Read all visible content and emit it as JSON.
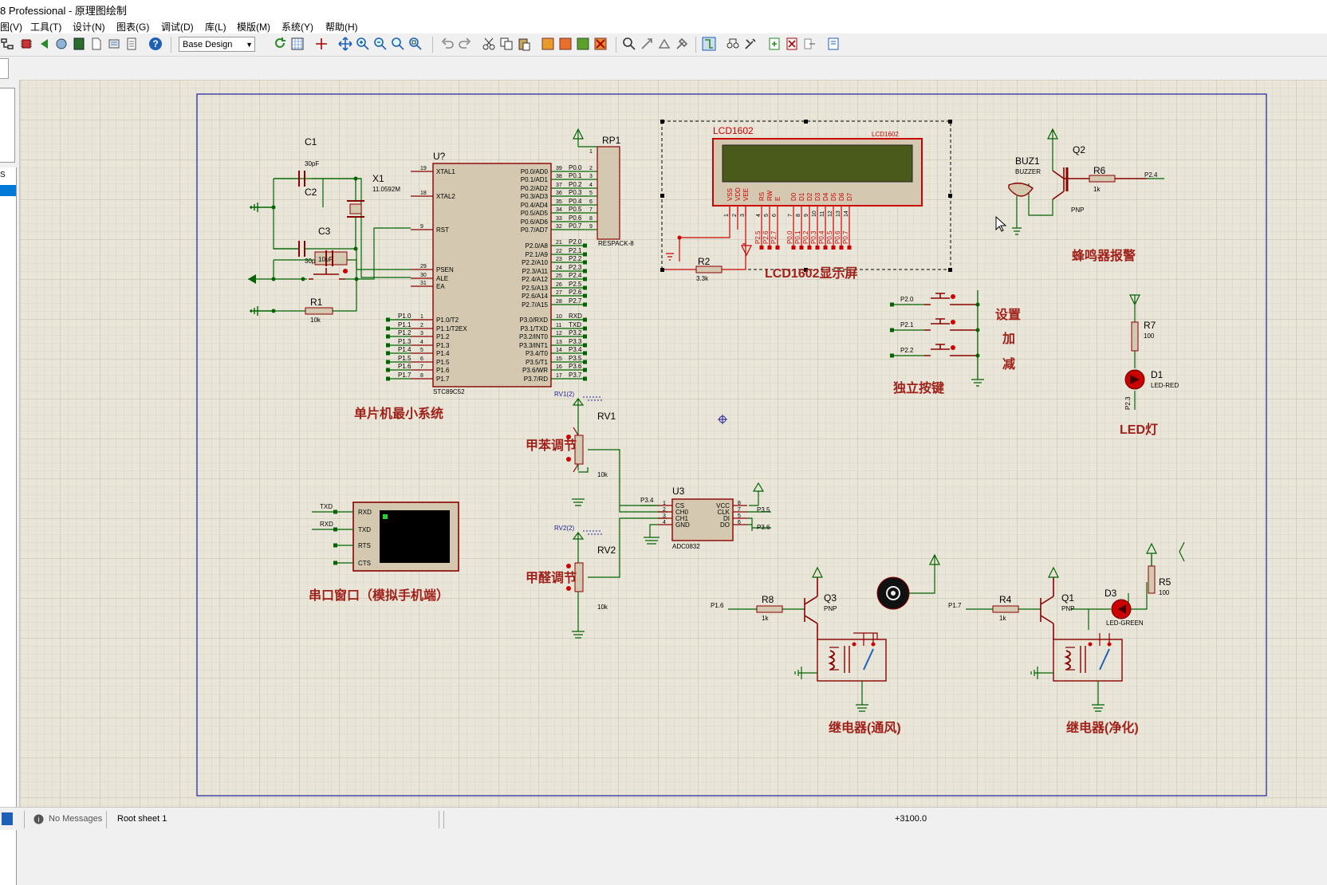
{
  "window": {
    "title": "8 Professional - 原理图绘制"
  },
  "menu": [
    "图(V)",
    "工具(T)",
    "设计(N)",
    "图表(G)",
    "调试(D)",
    "库(L)",
    "模版(M)",
    "系统(Y)",
    "帮助(H)"
  ],
  "toolbar": {
    "design_select": "Base Design"
  },
  "left_panel": {
    "item": "S"
  },
  "status": {
    "messages": "No Messages",
    "sheet": "Root sheet 1",
    "coordinate": "+3100.0"
  },
  "colors": {
    "wire": "#006400",
    "component": "#8b0000",
    "component_body": "#d4c9b0",
    "grid_bg": "#e9e6d9",
    "pin_text": "#0000a0",
    "border": "#1f1f9a"
  },
  "schematic": {
    "section_labels": [
      "单片机最小系统",
      "LCD1602显示屏",
      "蜂鸣器报警",
      "独立按键",
      "设置",
      "加",
      "减",
      "LED灯",
      "甲苯调节",
      "甲醛调节",
      "串口窗口（模拟手机端）",
      "继电器(通风)",
      "继电器(净化)"
    ],
    "refs": {
      "c1": "C1",
      "c2": "C2",
      "c3": "C3",
      "x1": "X1",
      "r1": "R1",
      "r2": "R2",
      "u": "U?",
      "rp1": "RP1",
      "lcd": "LCD1602",
      "lcd_small": "LCD1602",
      "buz1": "BUZ1",
      "q2": "Q2",
      "r6": "R6",
      "r7": "R7",
      "d1": "D1",
      "rv1": "RV1",
      "rv2": "RV2",
      "u3": "U3",
      "r8": "R8",
      "q3": "Q3",
      "r4": "R4",
      "q1": "Q1",
      "d3": "D3",
      "r5": "R5"
    },
    "values": {
      "c1": "30pF",
      "c2": "30pF",
      "c3": "10uF",
      "x1": "11.0592M",
      "r1": "10k",
      "r2": "3.3k",
      "rp1": "RESPACK-8",
      "u": "STC89C52",
      "buz1": "BUZZER",
      "q2": "PNP",
      "r6": "1k",
      "r7": "100",
      "d1": "LED-RED",
      "rv1": "10k",
      "rv2": "10k",
      "u3": "ADC0832",
      "r8": "1k",
      "q3": "PNP",
      "r4": "1k",
      "q1": "PNP",
      "d3": "LED-GREEN",
      "r5": "100"
    },
    "mcu_left_pins": [
      "XTAL1",
      "XTAL2",
      "RST",
      "PSEN",
      "ALE",
      "EA",
      "P1.0/T2",
      "P1.1/T2EX",
      "P1.2",
      "P1.3",
      "P1.4",
      "P1.5",
      "P1.6",
      "P1.7"
    ],
    "mcu_left_nums": [
      "19",
      "18",
      "9",
      "29",
      "30",
      "31",
      "1",
      "2",
      "3",
      "4",
      "5",
      "6",
      "7",
      "8"
    ],
    "mcu_p1_nets": [
      "P1.0",
      "P1.1",
      "P1.2",
      "P1.3",
      "P1.4",
      "P1.5",
      "P1.6",
      "P1.7"
    ],
    "mcu_right_pins": [
      "P0.0/AD0",
      "P0.1/AD1",
      "P0.2/AD2",
      "P0.3/AD3",
      "P0.4/AD4",
      "P0.5/AD5",
      "P0.6/AD6",
      "P0.7/AD7",
      "P2.0/A8",
      "P2.1/A9",
      "P2.2/A10",
      "P2.3/A11",
      "P2.4/A12",
      "P2.5/A13",
      "P2.6/A14",
      "P2.7/A15",
      "P3.0/RXD",
      "P3.1/TXD",
      "P3.2/INT0",
      "P3.3/INT1",
      "P3.4/T0",
      "P3.5/T1",
      "P3.6/WR",
      "P3.7/RD"
    ],
    "mcu_right_nums": [
      "39",
      "38",
      "37",
      "36",
      "35",
      "34",
      "33",
      "32",
      "21",
      "22",
      "23",
      "24",
      "25",
      "26",
      "27",
      "28",
      "10",
      "11",
      "12",
      "13",
      "14",
      "15",
      "16",
      "17"
    ],
    "mcu_right_nets": [
      "P0.0",
      "P0.1",
      "P0.2",
      "P0.3",
      "P0.4",
      "P0.5",
      "P0.6",
      "P0.7",
      "P2.0",
      "P2.1",
      "P2.2",
      "P2.3",
      "P2.4",
      "P2.5",
      "P2.6",
      "P2.7",
      "RXD",
      "TXD",
      "P3.2",
      "P3.3",
      "P3.4",
      "P3.5",
      "P3.6",
      "P3.7"
    ],
    "rp1_nums": [
      "1",
      "2",
      "3",
      "4",
      "5",
      "6",
      "7",
      "8",
      "9"
    ],
    "lcd_pins": [
      "VSS",
      "VDD",
      "VEE",
      "RS",
      "RW",
      "E",
      "D0",
      "D1",
      "D2",
      "D3",
      "D4",
      "D5",
      "D6",
      "D7"
    ],
    "lcd_nets": [
      "P2.5",
      "P2.6",
      "P2.7",
      "P0.0",
      "P0.1",
      "P0.2",
      "P0.3",
      "P0.4",
      "P0.5",
      "P0.6",
      "P0.7"
    ],
    "lcd_nums": [
      "1",
      "2",
      "3",
      "4",
      "5",
      "6",
      "7",
      "8",
      "9",
      "10",
      "11",
      "12",
      "13",
      "14"
    ],
    "key_nets": [
      "P2.0",
      "P2.1",
      "P2.2"
    ],
    "adc_left_pins": [
      "CS",
      "CH0",
      "CH1",
      "GND"
    ],
    "adc_right_pins": [
      "VCC",
      "CLK",
      "DI",
      "DO"
    ],
    "adc_left_nums": [
      "1",
      "2",
      "3",
      "4"
    ],
    "adc_right_nums": [
      "8",
      "7",
      "5",
      "6"
    ],
    "adc_nets": {
      "cs": "P3.4",
      "clk": "P3.5",
      "dido": "P3.6"
    },
    "probes": {
      "rv1": "RV1(2)",
      "rv2": "RV2(2)"
    },
    "serial_pins": [
      "RXD",
      "TXD",
      "RTS",
      "CTS"
    ],
    "serial_nets": [
      "TXD",
      "RXD"
    ],
    "nets": {
      "q2": "P2.4",
      "d1": "P2.3",
      "q3": "P1.6",
      "q1": "P1.7"
    }
  }
}
